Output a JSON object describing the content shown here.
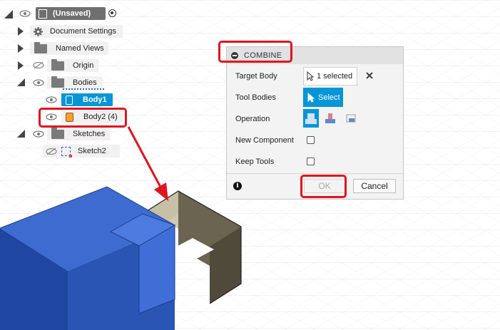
{
  "browser": {
    "root_label": "(Unsaved)",
    "items": [
      {
        "label": "Document Settings"
      },
      {
        "label": "Named Views"
      },
      {
        "label": "Origin"
      },
      {
        "label": "Bodies"
      },
      {
        "label": "Body1"
      },
      {
        "label": "Body2 (4)"
      },
      {
        "label": "Sketches"
      },
      {
        "label": "Sketch2"
      }
    ]
  },
  "combine": {
    "title": "COMBINE",
    "target_body_label": "Target Body",
    "target_body_value": "1 selected",
    "tool_bodies_label": "Tool Bodies",
    "tool_bodies_button": "Select",
    "operation_label": "Operation",
    "new_component_label": "New Component",
    "keep_tools_label": "Keep Tools",
    "ok_label": "OK",
    "cancel_label": "Cancel"
  },
  "colors": {
    "selection_blue": "#0696d7",
    "highlight_red": "#e0141e",
    "body_blue": "#2f5fbf",
    "body_olive": "#5e5945"
  }
}
